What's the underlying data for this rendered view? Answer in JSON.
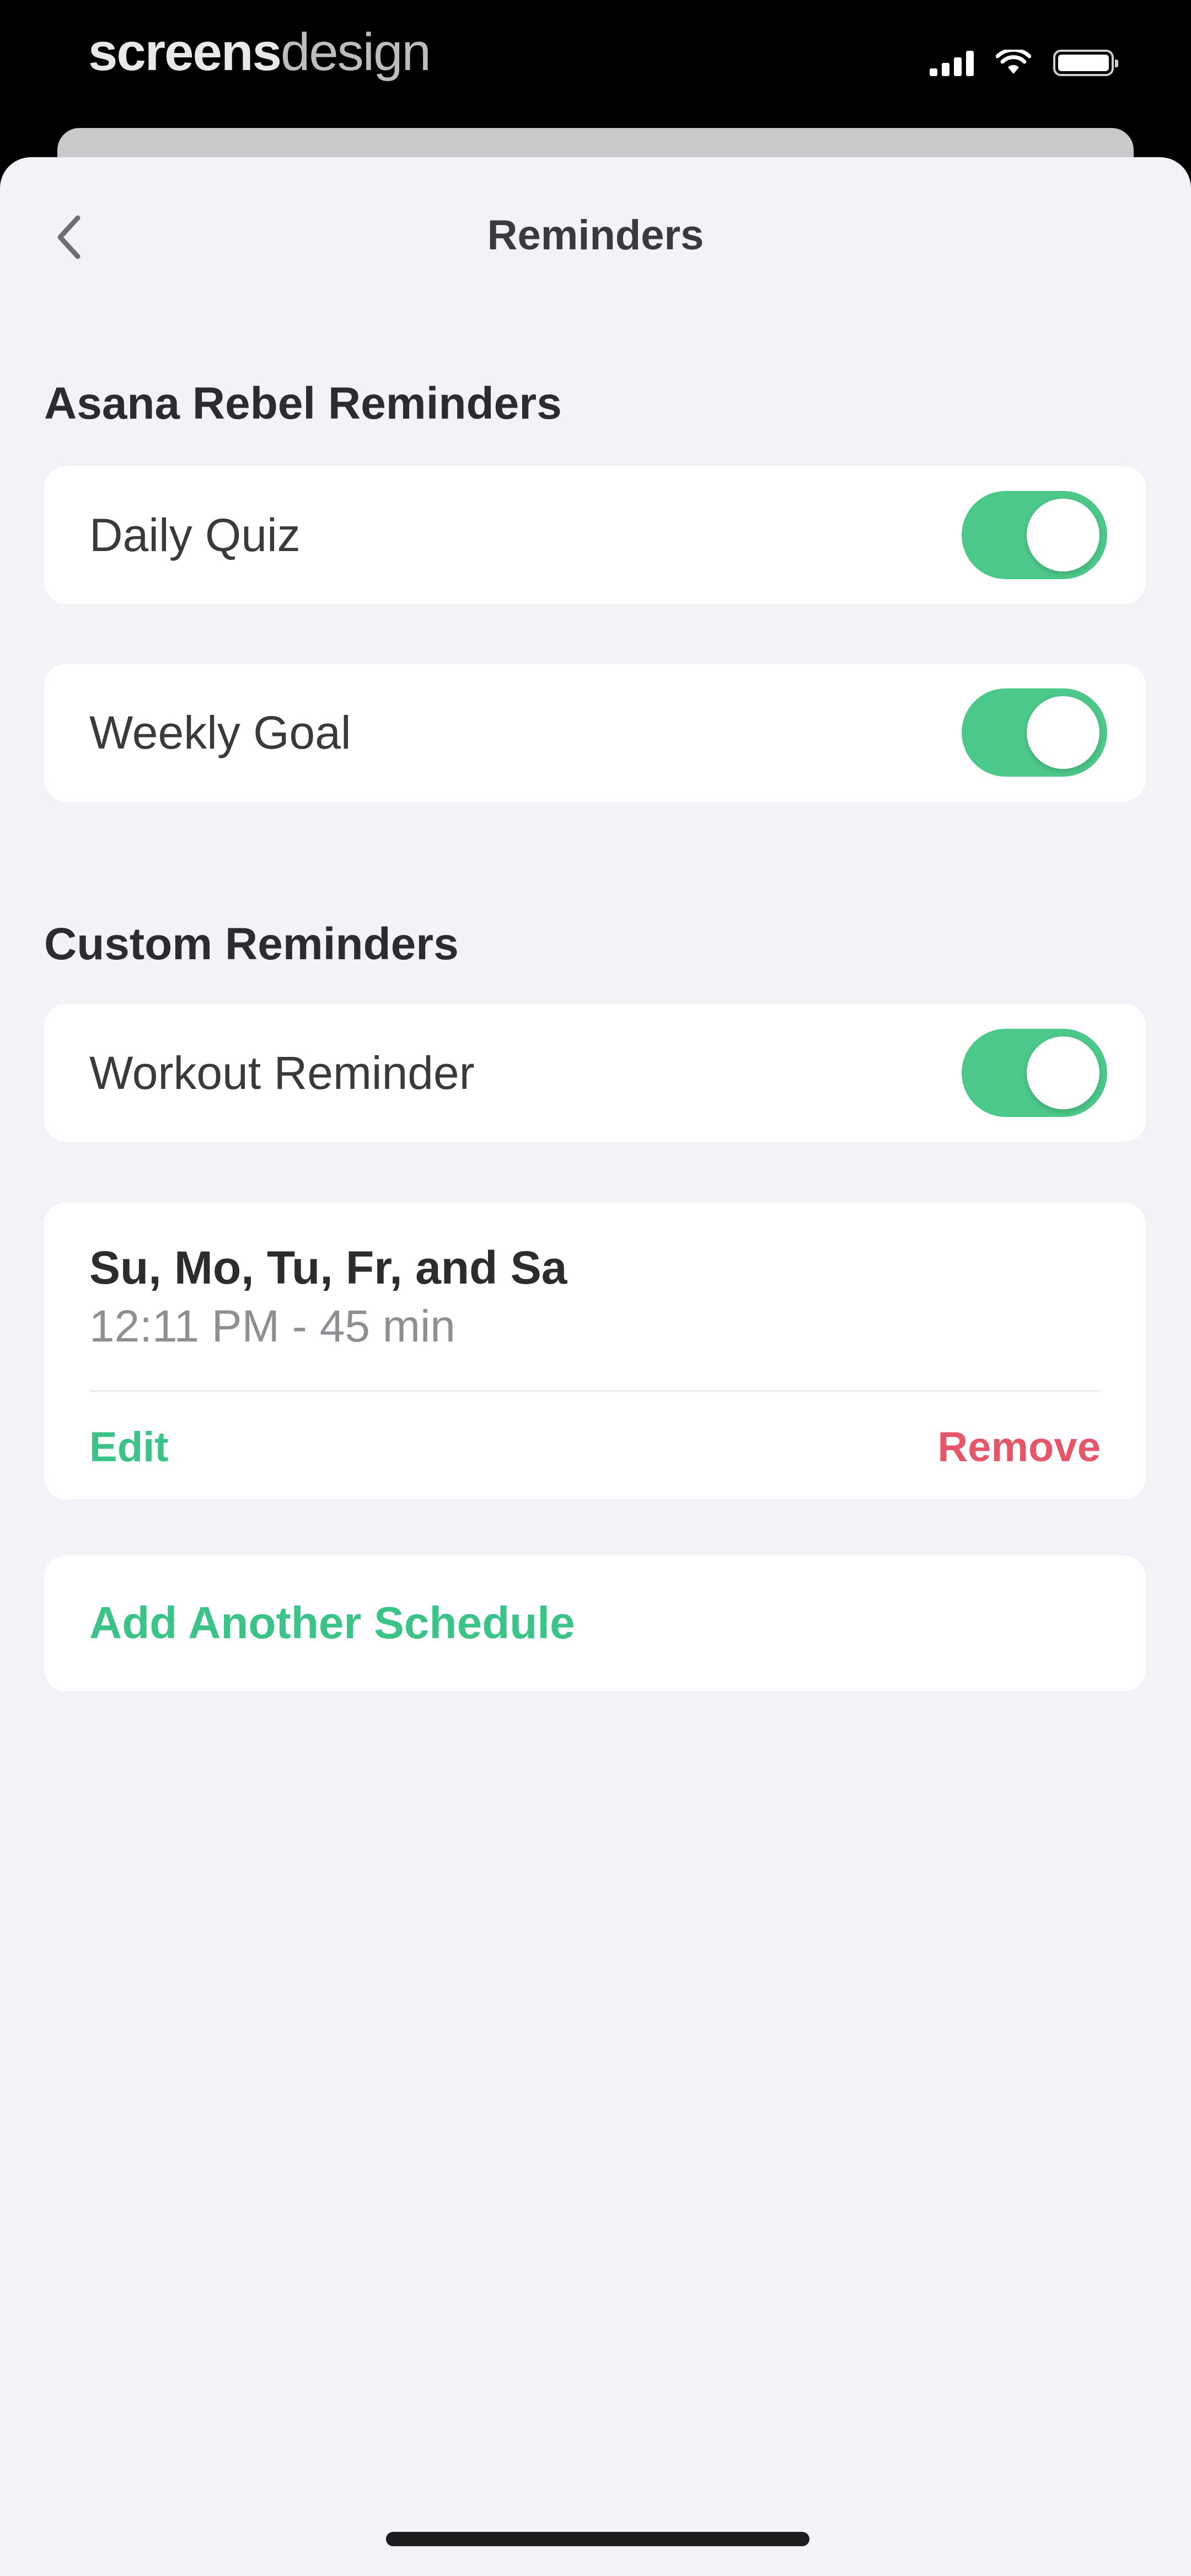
{
  "status_bar": {
    "brand_bold": "screens",
    "brand_light": "design",
    "icons": [
      "cellular-signal-icon",
      "wifi-icon",
      "battery-icon"
    ]
  },
  "nav": {
    "title": "Reminders",
    "back_icon": "chevron-left-icon"
  },
  "sections": {
    "app_reminders": {
      "header": "Asana Rebel Reminders",
      "items": [
        {
          "label": "Daily Quiz",
          "enabled": true
        },
        {
          "label": "Weekly Goal",
          "enabled": true
        }
      ]
    },
    "custom_reminders": {
      "header": "Custom Reminders",
      "workout": {
        "label": "Workout Reminder",
        "enabled": true
      },
      "schedule": {
        "days": "Su, Mo, Tu, Fr, and Sa",
        "time": "12:11 PM - 45 min",
        "edit_label": "Edit",
        "remove_label": "Remove"
      },
      "add_label": "Add Another Schedule"
    }
  },
  "colors": {
    "accent_green": "#3cc488",
    "toggle_on": "#4cc98a",
    "destructive_red": "#e5566a",
    "background": "#f2f2f7"
  }
}
